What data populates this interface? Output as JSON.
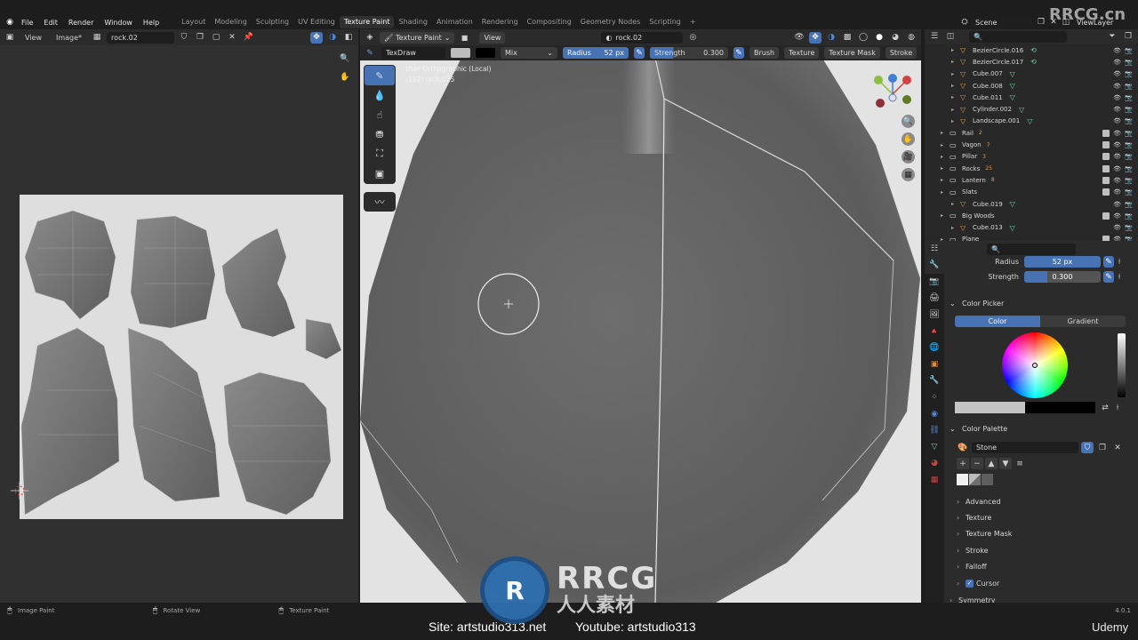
{
  "menu": [
    "File",
    "Edit",
    "Render",
    "Window",
    "Help"
  ],
  "workspaces": [
    "Layout",
    "Modeling",
    "Sculpting",
    "UV Editing",
    "Texture Paint",
    "Shading",
    "Animation",
    "Rendering",
    "Compositing",
    "Geometry Nodes",
    "Scripting"
  ],
  "active_workspace": "Texture Paint",
  "scene": "Scene",
  "view_layer": "ViewLayer",
  "image_editor": {
    "view": "View",
    "image_menu": "Image*",
    "image_name": "rock.02",
    "status_label": "Image Paint"
  },
  "viewport": {
    "mode": "Texture Paint",
    "view_menu": "View",
    "material": "rock.02",
    "brush_name": "TexDraw",
    "blend": "Mix",
    "radius_label": "Radius",
    "radius_value": "52 px",
    "strength_label": "Strength",
    "strength_value": "0.300",
    "brush_menu": "Brush",
    "texture_menu": "Texture",
    "texture_mask_menu": "Texture Mask",
    "stroke_menu": "Stroke",
    "overlay_line1": "User Orthographic (Local)",
    "overlay_line2": "(192) rock.025",
    "status_rotate": "Rotate View",
    "status_texpaint": "Texture Paint"
  },
  "outliner": {
    "rows": [
      {
        "name": "BezierCircle.016",
        "indent": 2,
        "type": "curve"
      },
      {
        "name": "BezierCircle.017",
        "indent": 2,
        "type": "curve"
      },
      {
        "name": "Cube.007",
        "indent": 2,
        "type": "mesh"
      },
      {
        "name": "Cube.008",
        "indent": 2,
        "type": "mesh"
      },
      {
        "name": "Cube.011",
        "indent": 2,
        "type": "mesh"
      },
      {
        "name": "Cylinder.002",
        "indent": 2,
        "type": "mesh"
      },
      {
        "name": "Landscape.001",
        "indent": 2,
        "type": "mesh"
      },
      {
        "name": "Rail",
        "indent": 1,
        "type": "collection",
        "count": "2"
      },
      {
        "name": "Vagon",
        "indent": 1,
        "type": "collection",
        "count": "7"
      },
      {
        "name": "Pillar",
        "indent": 1,
        "type": "collection",
        "count": "3"
      },
      {
        "name": "Rocks",
        "indent": 1,
        "type": "collection",
        "count": "25"
      },
      {
        "name": "Lantern",
        "indent": 1,
        "type": "collection",
        "count": "8"
      },
      {
        "name": "Slats",
        "indent": 1,
        "type": "collection"
      },
      {
        "name": "Cube.019",
        "indent": 2,
        "type": "mesh"
      },
      {
        "name": "Big Woods",
        "indent": 1,
        "type": "collection"
      },
      {
        "name": "Cube.013",
        "indent": 2,
        "type": "mesh"
      },
      {
        "name": "Plane",
        "indent": 1,
        "type": "collection"
      }
    ]
  },
  "properties": {
    "radius_label": "Radius",
    "radius_value": "52 px",
    "strength_label": "Strength",
    "strength_value": "0.300",
    "color_picker": "Color Picker",
    "tab_color": "Color",
    "tab_gradient": "Gradient",
    "color_palette": "Color Palette",
    "palette_name": "Stone",
    "panels": [
      "Advanced",
      "Texture",
      "Texture Mask",
      "Stroke",
      "Falloff",
      "Cursor",
      "Symmetry"
    ]
  },
  "version": "4.0.1",
  "watermark_top": "RRCG.cn",
  "watermark_brand": "RRCG",
  "watermark_cn": "人人素材",
  "footer": {
    "site": "Site: artstudio313.net",
    "youtube": "Youtube: artstudio313",
    "udemy": "Udemy"
  },
  "colors": {
    "accent": "#4772b3",
    "header": "#2b2b2b",
    "background": "#1d1d1d",
    "outliner_mesh": "#6fd6a0",
    "outliner_collection": "#e09a53"
  }
}
